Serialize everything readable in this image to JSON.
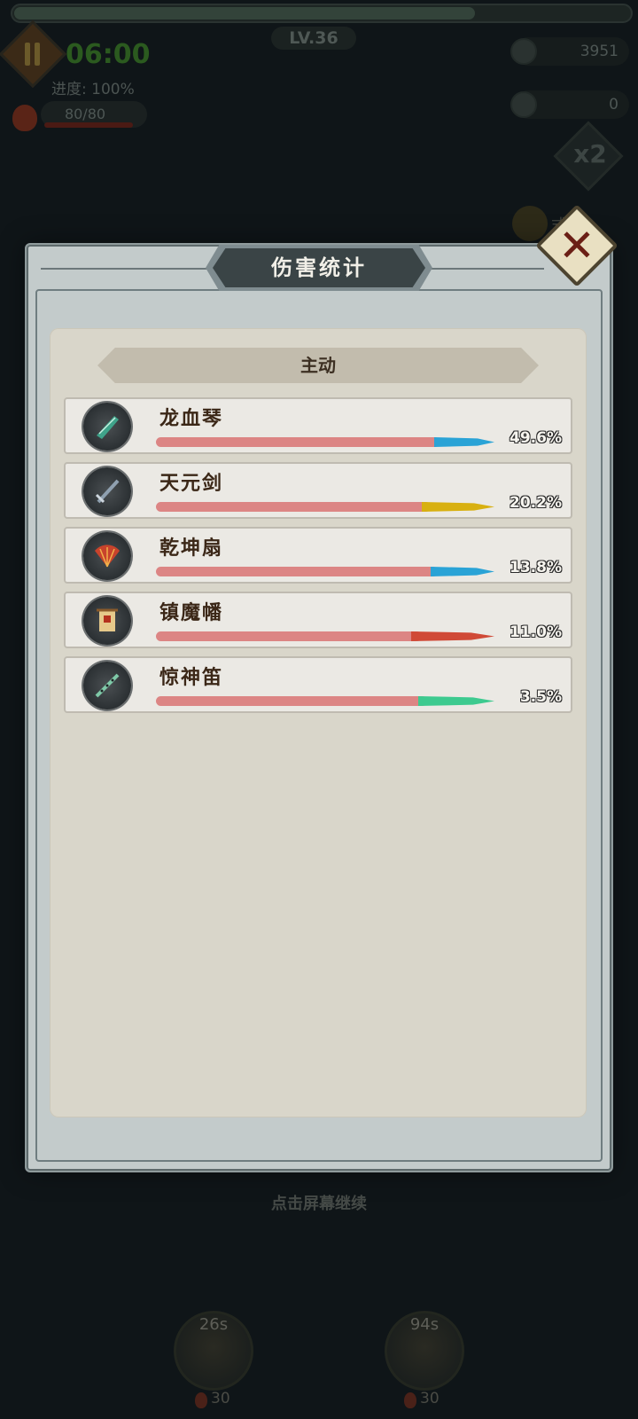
{
  "hud": {
    "level": "LV.36",
    "timer": "06:00",
    "progress": "进度: 100%",
    "hp": "80/80",
    "resource_1": "3951",
    "resource_2": "0",
    "speed": "x2",
    "auto_label": "式",
    "continue_hint": "点击屏幕继续",
    "skill_1_cooldown": "26s",
    "skill_1_cost": "30",
    "skill_2_cooldown": "94s",
    "skill_2_cost": "30"
  },
  "panel": {
    "title": "伤害统计",
    "close_icon": "close-x-icon",
    "section": "主动",
    "rows": [
      {
        "name": "龙血琴",
        "percent": "49.6%",
        "tip_color": "#2aa3d6",
        "icon": "qin-instrument-icon"
      },
      {
        "name": "天元剑",
        "percent": "20.2%",
        "tip_color": "#d8b010",
        "icon": "sword-icon"
      },
      {
        "name": "乾坤扇",
        "percent": "13.8%",
        "tip_color": "#2aa3d6",
        "icon": "fan-icon"
      },
      {
        "name": "镇魔幡",
        "percent": "11.0%",
        "tip_color": "#d04a37",
        "icon": "banner-icon"
      },
      {
        "name": "惊神笛",
        "percent": "3.5%",
        "tip_color": "#3dca8f",
        "icon": "flute-icon"
      }
    ]
  },
  "colors": {
    "bar_base": "#dc8584",
    "panel_bg": "#c3cbcb",
    "content_bg": "#d9d6ca"
  }
}
